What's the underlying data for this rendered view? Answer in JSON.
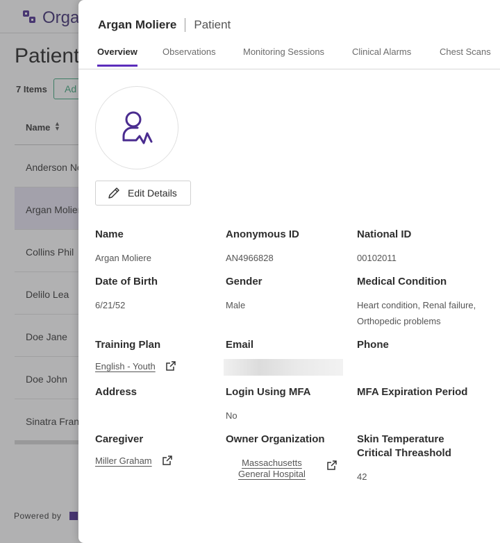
{
  "background": {
    "logo_text": "Orga",
    "page_title": "Patient",
    "items_count": "7 Items",
    "add_button": "Ad",
    "column_name": "Name",
    "rows": [
      "Anderson Ne",
      "Argan Molier",
      "Collins Phil",
      "Delilo Lea",
      "Doe Jane",
      "Doe John",
      "Sinatra Frank"
    ],
    "powered_by": "Powered by"
  },
  "drawer": {
    "patient_name": "Argan Moliere",
    "record_type": "Patient",
    "tabs": [
      "Overview",
      "Observations",
      "Monitoring Sessions",
      "Clinical Alarms",
      "Chest Scans"
    ],
    "edit_button": "Edit Details",
    "fields": {
      "name": {
        "label": "Name",
        "value": "Argan Moliere"
      },
      "anonymous_id": {
        "label": "Anonymous ID",
        "value": "AN4966828"
      },
      "national_id": {
        "label": "National ID",
        "value": "00102011"
      },
      "dob": {
        "label": "Date of Birth",
        "value": "6/21/52"
      },
      "gender": {
        "label": "Gender",
        "value": "Male"
      },
      "medical_condition": {
        "label": "Medical Condition",
        "value": "Heart condition, Renal failure, Orthopedic problems"
      },
      "training_plan": {
        "label": "Training Plan",
        "value": "English - Youth"
      },
      "email": {
        "label": "Email",
        "value": ""
      },
      "phone": {
        "label": "Phone",
        "value": ""
      },
      "address": {
        "label": "Address",
        "value": ""
      },
      "login_mfa": {
        "label": "Login Using MFA",
        "value": "No"
      },
      "mfa_expiration": {
        "label": "MFA Expiration Period",
        "value": ""
      },
      "caregiver": {
        "label": "Caregiver",
        "value": "Miller Graham"
      },
      "owner_org": {
        "label": "Owner Organization",
        "value_line1": "Massachusetts",
        "value_line2": "General Hospital"
      },
      "skin_temp": {
        "label": "Skin Temperature Critical Threashold",
        "value": "42"
      }
    }
  },
  "colors": {
    "accent": "#5b2dbb",
    "brand": "#4a2c8f",
    "add_green": "#3aa57a"
  }
}
